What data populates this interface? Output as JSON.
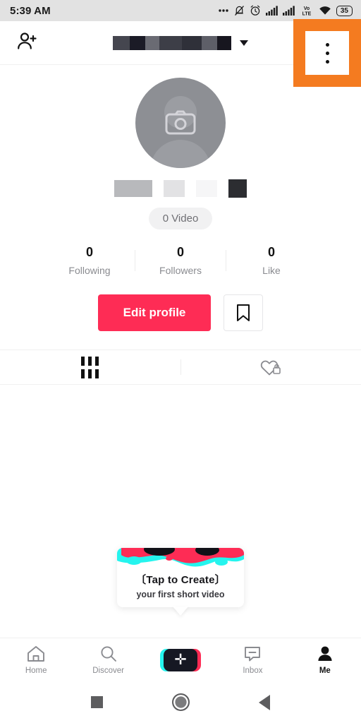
{
  "status_bar": {
    "time": "5:39 AM",
    "battery_level": "35",
    "icons": [
      "more-dots-icon",
      "bell-muted-icon",
      "alarm-clock-icon",
      "signal-bars-icon",
      "signal-bars-2-icon",
      "volte-icon",
      "wifi-icon",
      "battery-icon"
    ],
    "volte_top": "Vo",
    "volte_bottom": "LTE",
    "background": "#e2e2e2"
  },
  "header": {
    "add_friend_icon": "add-person-icon",
    "username_redacted": true,
    "username_blocks": [
      "#45464f",
      "#1b1b26",
      "#6a6b73",
      "#3d3e47",
      "#2f3039",
      "#5e5f68",
      "#17161f"
    ],
    "dropdown_icon": "chevron-down-icon",
    "menu_icon": "three-dots-vertical-icon",
    "highlight_color": "#f47b20"
  },
  "profile": {
    "avatar_icon": "camera-icon",
    "avatar_placeholder": "default-person-avatar",
    "avatar_color": "#8d8f94",
    "name_redacted_blocks": [
      "#b8b9bc",
      "#e2e2e4",
      "#f4f4f5",
      "#2c2d31"
    ],
    "video_count_label": "0 Video"
  },
  "stats": [
    {
      "value": "0",
      "label": "Following"
    },
    {
      "value": "0",
      "label": "Followers"
    },
    {
      "value": "0",
      "label": "Like"
    }
  ],
  "actions": {
    "edit_profile_label": "Edit profile",
    "edit_profile_color": "#fe2c55",
    "bookmark_icon": "bookmark-icon"
  },
  "tabs": [
    {
      "icon": "grid-posts-icon",
      "active": true
    },
    {
      "icon": "heart-lock-private-icon",
      "active": false
    }
  ],
  "tooltip": {
    "title": "〔Tap to Create〕",
    "subtitle": "your first short video",
    "blob_colors": [
      "#25f4ee",
      "#fe2c55",
      "#111118",
      "#ffffff"
    ]
  },
  "bottom_nav": [
    {
      "icon": "home-icon",
      "label": "Home",
      "active": false
    },
    {
      "icon": "search-icon",
      "label": "Discover",
      "active": false
    },
    {
      "icon": "create-plus-icon",
      "label": "",
      "active": false
    },
    {
      "icon": "inbox-message-icon",
      "label": "Inbox",
      "active": false
    },
    {
      "icon": "person-icon",
      "label": "Me",
      "active": true
    }
  ],
  "android_nav": {
    "recents_icon": "square-recents-icon",
    "home_icon": "circle-home-icon",
    "back_icon": "triangle-back-icon"
  }
}
